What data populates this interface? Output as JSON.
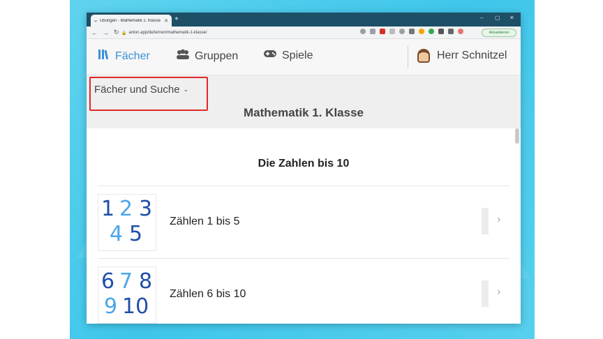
{
  "browser": {
    "tab_title": "Übungen - Mathematik 1. Klasse",
    "tab_close": "✕",
    "new_tab": "+",
    "url": "anton.app/de/lernen/mathematik-1-klasse/",
    "update_button": "Aktualisieren",
    "window_controls": [
      "–",
      "▢",
      "✕"
    ]
  },
  "nav": {
    "items": [
      {
        "label": "Fächer",
        "icon": "books-icon",
        "active": true
      },
      {
        "label": "Gruppen",
        "icon": "group-icon",
        "active": false
      },
      {
        "label": "Spiele",
        "icon": "gamepad-icon",
        "active": false
      }
    ],
    "user_name": "Herr Schnitzel"
  },
  "subheader": {
    "subjects_dropdown": "Fächer und Suche",
    "page_title": "Mathematik 1. Klasse"
  },
  "content": {
    "section_title": "Die Zahlen bis 10",
    "rows": [
      {
        "label": "Zählen 1 bis 5",
        "thumb_top": [
          "1",
          "2",
          "3"
        ],
        "thumb_bottom": [
          "4",
          "5"
        ]
      },
      {
        "label": "Zählen 6 bis 10",
        "thumb_top": [
          "6",
          "7",
          "8"
        ],
        "thumb_bottom": [
          "9",
          "10"
        ]
      }
    ]
  },
  "colors": {
    "accent": "#3a8fd8",
    "highlight": "#e02828",
    "titlebar": "#1d4f67",
    "digit_dark": "#1f4ea8",
    "digit_light": "#4aa6e8"
  }
}
